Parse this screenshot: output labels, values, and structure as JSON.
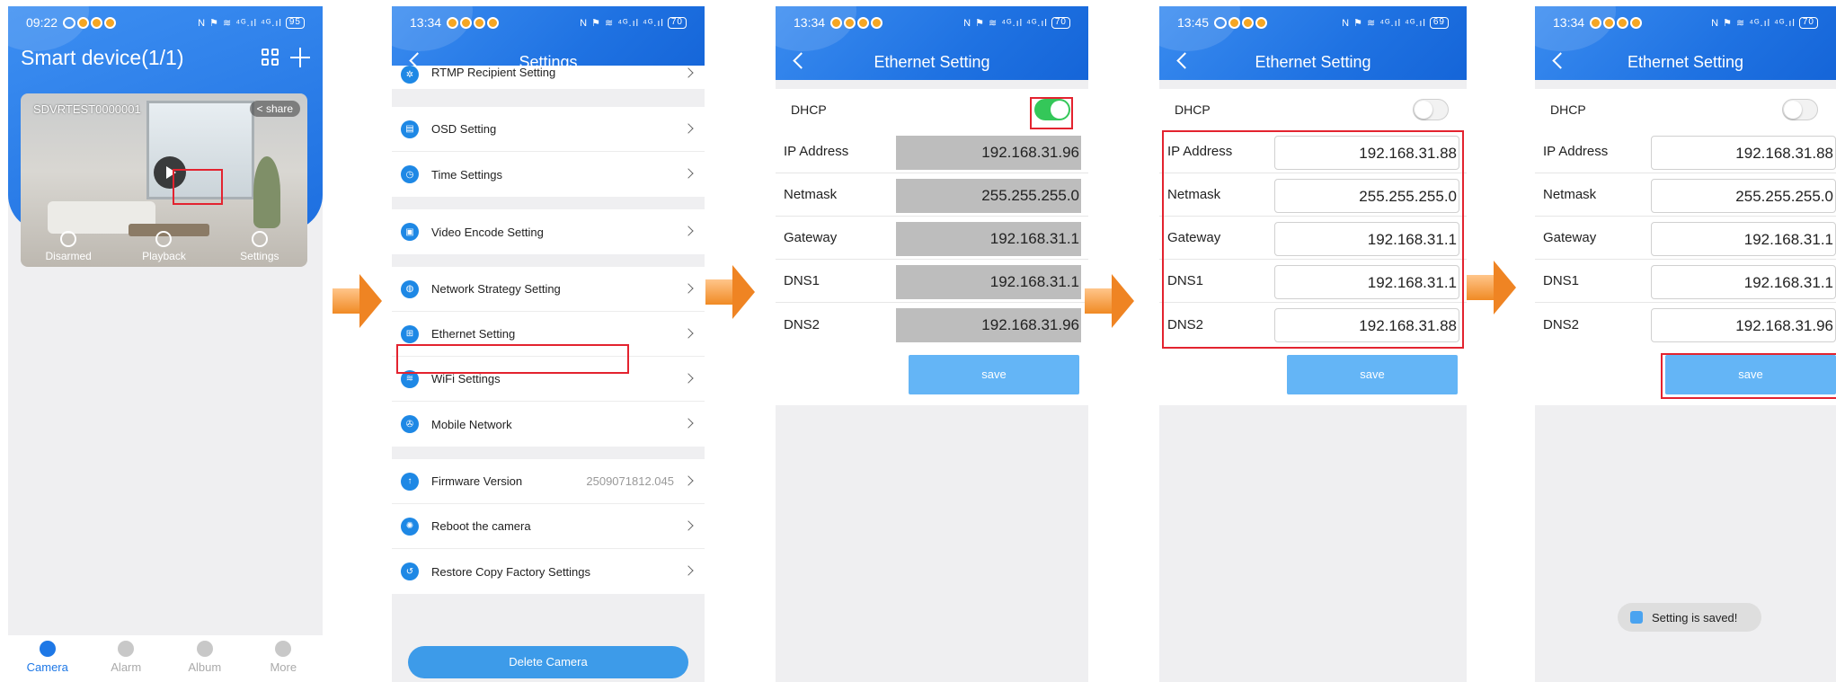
{
  "status": {
    "p1_time": "09:22",
    "p1_batt": "95",
    "p2_time": "13:34",
    "p2_batt": "70",
    "p3_time": "13:34",
    "p3_batt": "70",
    "p4_time": "13:45",
    "p4_batt": "69",
    "p5_time": "13:34",
    "p5_batt": "70",
    "signal": "N ⚑ ≋ ⁴ᴳ.ıl ⁴ᴳ.ıl"
  },
  "home": {
    "title": "Smart device(1/1)",
    "device_name": "SDVRTEST0000001",
    "share_label": "share",
    "actions": [
      "Disarmed",
      "Playback",
      "Settings"
    ],
    "tabs": [
      "Camera",
      "Alarm",
      "Album",
      "More"
    ]
  },
  "settings": {
    "title": "Settings",
    "groups": [
      [
        "RTMP Recipient Setting"
      ],
      [
        "OSD Setting",
        "Time Settings"
      ],
      [
        "Video Encode Setting"
      ],
      [
        "Network Strategy Setting",
        "Ethernet Setting",
        "WiFi Settings",
        "Mobile Network"
      ],
      [
        "Firmware Version",
        "Reboot the camera",
        "Restore Copy Factory Settings"
      ]
    ],
    "firmware_value": "2509071812.045",
    "delete_label": "Delete Camera"
  },
  "ethernet": {
    "title": "Ethernet Setting",
    "dhcp_label": "DHCP",
    "labels": [
      "IP Address",
      "Netmask",
      "Gateway",
      "DNS1",
      "DNS2"
    ],
    "save_label": "save",
    "screen3_values": [
      "192.168.31.96",
      "255.255.255.0",
      "192.168.31.1",
      "192.168.31.1",
      "192.168.31.96"
    ],
    "screen4_values": [
      "192.168.31.88",
      "255.255.255.0",
      "192.168.31.1",
      "192.168.31.1",
      "192.168.31.88"
    ],
    "screen5_values": [
      "192.168.31.88",
      "255.255.255.0",
      "192.168.31.1",
      "192.168.31.1",
      "192.168.31.96"
    ],
    "toast": "Setting is saved!"
  },
  "colors": {
    "header_blue": "#1f72e2",
    "highlight_red": "#e3232f",
    "toggle_green": "#34c759",
    "arrow_orange": "#f08a24",
    "save_blue": "#64b5f6"
  }
}
